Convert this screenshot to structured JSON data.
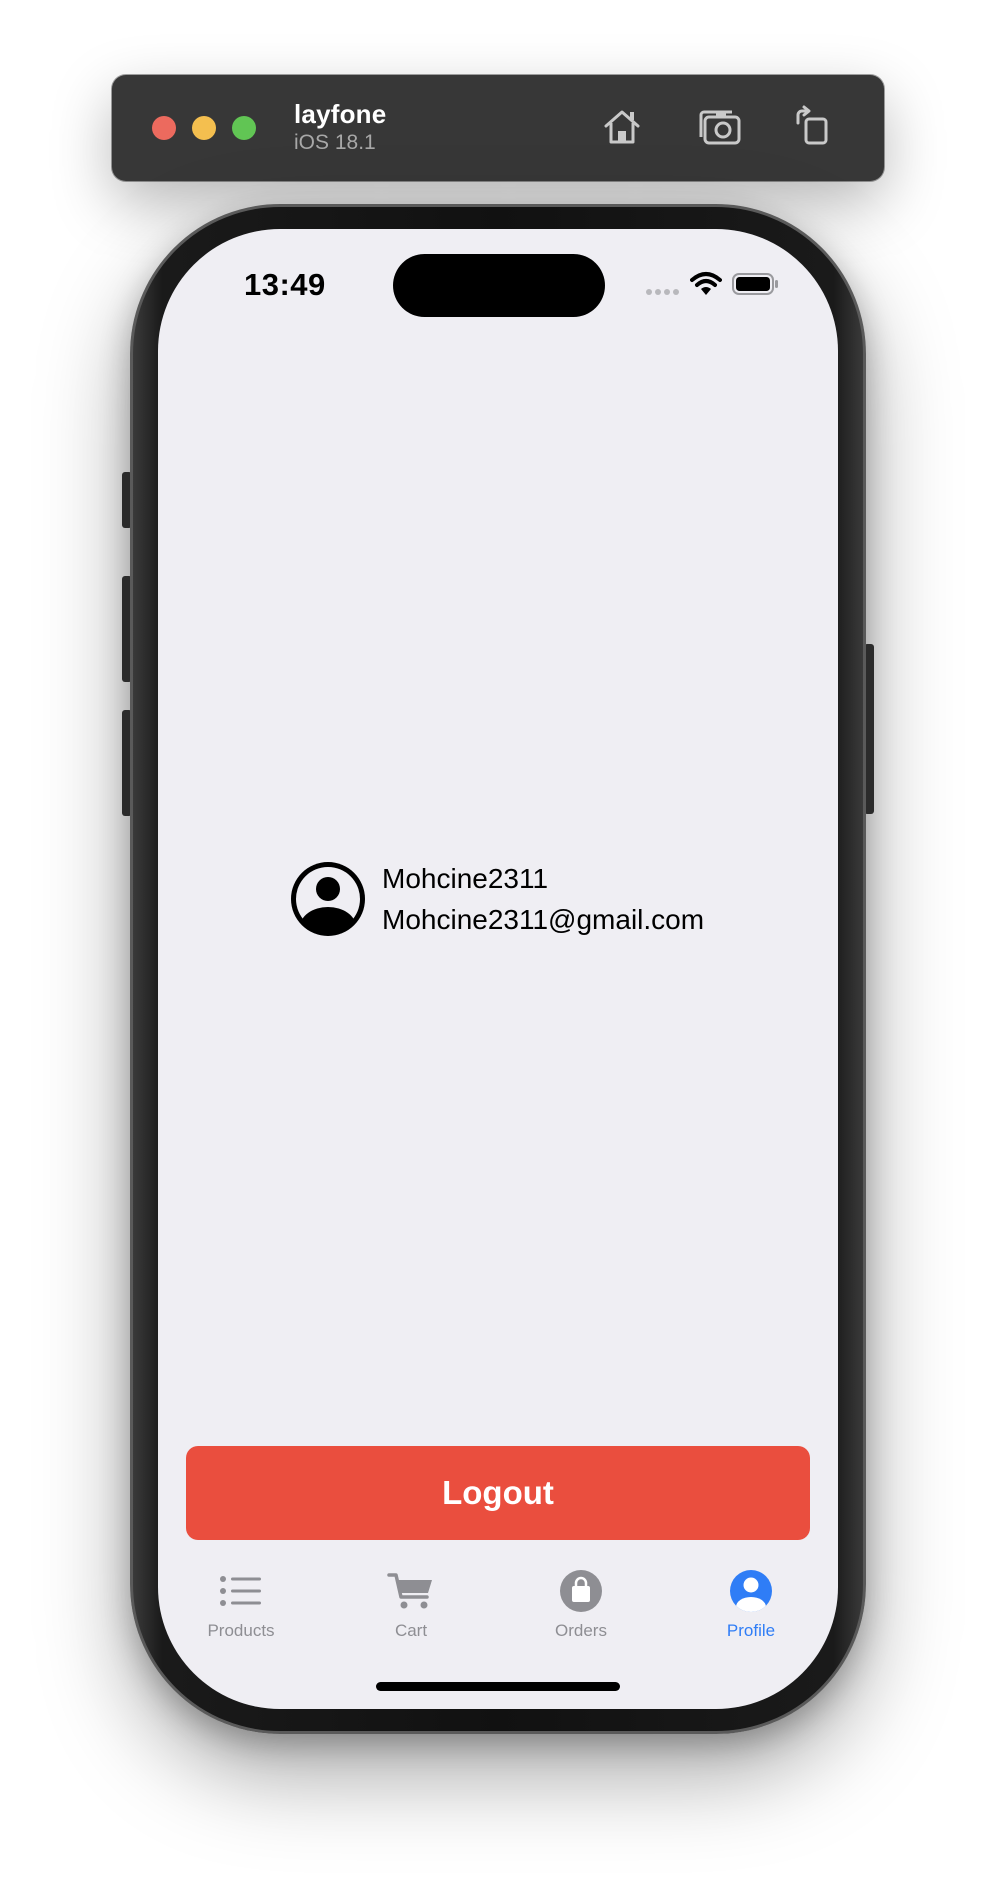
{
  "simulator": {
    "device_name": "layfone",
    "os_version": "iOS 18.1",
    "icons": [
      "home-icon",
      "screenshot-icon",
      "rotate-icon"
    ]
  },
  "status_bar": {
    "time": "13:49"
  },
  "profile": {
    "username": "Mohcine2311",
    "email": "Mohcine2311@gmail.com",
    "avatar_icon": "person-circle-icon"
  },
  "actions": {
    "logout_label": "Logout",
    "logout_color": "#ea4e3e"
  },
  "tabbar": {
    "active_color": "#2f7df6",
    "inactive_color": "#8e8e93",
    "tabs": [
      {
        "label": "Products",
        "icon": "list-icon",
        "active": false
      },
      {
        "label": "Cart",
        "icon": "cart-icon",
        "active": false
      },
      {
        "label": "Orders",
        "icon": "bag-icon",
        "active": false
      },
      {
        "label": "Profile",
        "icon": "person-icon",
        "active": true
      }
    ]
  }
}
